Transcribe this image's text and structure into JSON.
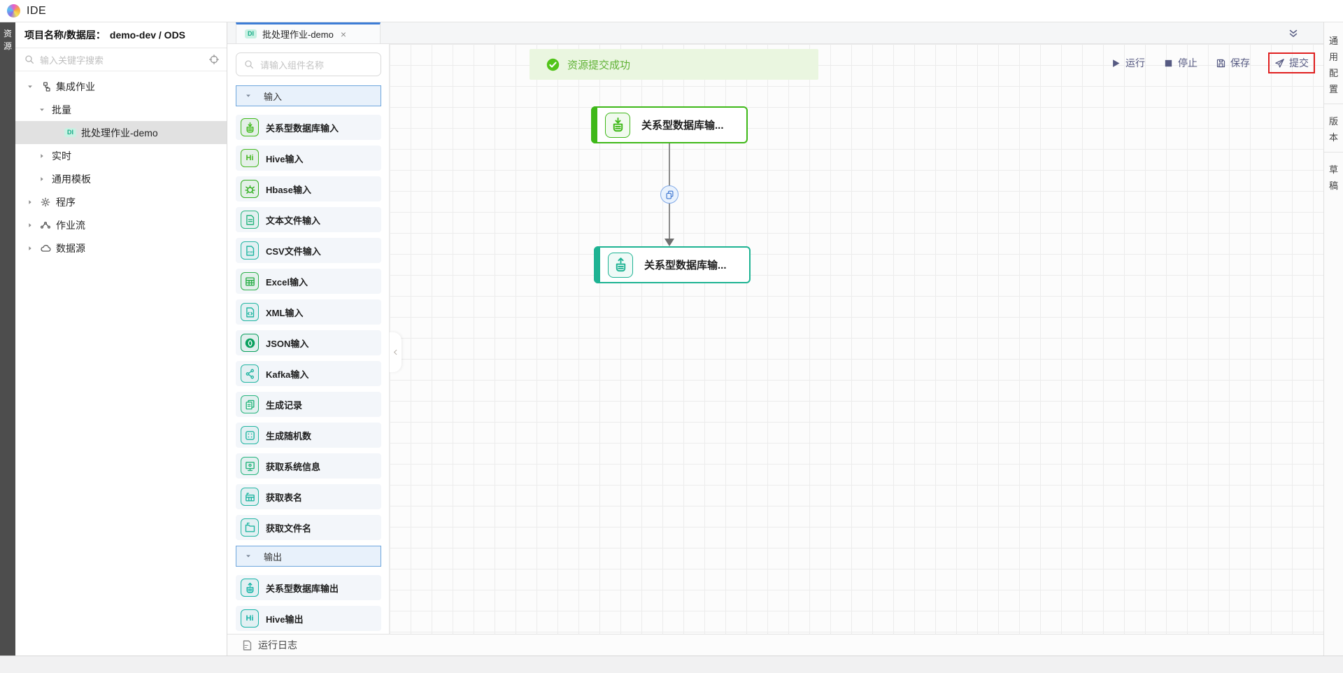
{
  "app": {
    "title": "IDE"
  },
  "activity_bar": {
    "label": "资源"
  },
  "sidebar": {
    "header_label": "项目名称/数据层：",
    "project_value": "demo-dev / ODS",
    "search_placeholder": "输入关键字搜索",
    "tree": [
      {
        "id": "integration-jobs",
        "label": "集成作业",
        "level": 0,
        "expanded": true,
        "icon": "sitemap"
      },
      {
        "id": "batch",
        "label": "批量",
        "level": 1,
        "expanded": true
      },
      {
        "id": "batch-job-demo",
        "label": "批处理作业-demo",
        "level": 2,
        "badge": "DI",
        "selected": true
      },
      {
        "id": "realtime",
        "label": "实时",
        "level": 1,
        "expanded": false
      },
      {
        "id": "common-template",
        "label": "通用模板",
        "level": 1,
        "expanded": false
      },
      {
        "id": "program",
        "label": "程序",
        "level": 0,
        "expanded": false,
        "icon": "gear"
      },
      {
        "id": "job-flow",
        "label": "作业流",
        "level": 0,
        "expanded": false,
        "icon": "flow"
      },
      {
        "id": "data-source",
        "label": "数据源",
        "level": 0,
        "expanded": false,
        "icon": "cloud"
      }
    ]
  },
  "tab": {
    "badge": "DI",
    "title": "批处理作业-demo",
    "close": "×"
  },
  "palette": {
    "search_placeholder": "请输入组件名称",
    "sections": [
      {
        "id": "input",
        "label": "输入",
        "items": [
          {
            "label": "关系型数据库输入",
            "icon": "db-in",
            "color": "#3eb818"
          },
          {
            "label": "Hive输入",
            "icon": "hive",
            "color": "#45b821"
          },
          {
            "label": "Hbase输入",
            "icon": "bug",
            "color": "#2fae1d"
          },
          {
            "label": "文本文件输入",
            "icon": "file-text",
            "color": "#27b57e"
          },
          {
            "label": "CSV文件输入",
            "icon": "file-csv",
            "color": "#23b6a2"
          },
          {
            "label": "Excel输入",
            "icon": "table",
            "color": "#2fb04c"
          },
          {
            "label": "XML输入",
            "icon": "file-xml",
            "color": "#23b6a2"
          },
          {
            "label": "JSON输入",
            "icon": "json",
            "color": "#0ba05e"
          },
          {
            "label": "Kafka输入",
            "icon": "kafka",
            "color": "#23b6a2"
          },
          {
            "label": "生成记录",
            "icon": "records",
            "color": "#27b57e"
          },
          {
            "label": "生成随机数",
            "icon": "dice",
            "color": "#23b6a2"
          },
          {
            "label": "获取系统信息",
            "icon": "monitor",
            "color": "#27b57e"
          },
          {
            "label": "获取表名",
            "icon": "table-flag",
            "color": "#23b6a2"
          },
          {
            "label": "获取文件名",
            "icon": "folder",
            "color": "#23b6a2"
          }
        ]
      },
      {
        "id": "output",
        "label": "输出",
        "items": [
          {
            "label": "关系型数据库输出",
            "icon": "db-out",
            "color": "#14b3a6"
          },
          {
            "label": "Hive输出",
            "icon": "hive",
            "color": "#14b3a6"
          }
        ]
      }
    ]
  },
  "toast": {
    "text": "资源提交成功",
    "icon_color": "#52c41a"
  },
  "toolbar": {
    "run_label": "运行",
    "stop_label": "停止",
    "save_label": "保存",
    "submit_label": "提交",
    "text_color": "#565a82",
    "highlight_color": "#e02020"
  },
  "canvas": {
    "nodes": [
      {
        "label": "关系型数据库输...",
        "icon": "db-in",
        "color": "#3eb818"
      },
      {
        "label": "关系型数据库输...",
        "icon": "db-out",
        "color": "#1eb393"
      }
    ],
    "edge": {
      "midpoint_icon": "copy",
      "midpoint_color": "#4a7fd4"
    }
  },
  "right_bar": {
    "tabs": [
      {
        "id": "general-config",
        "label": "通用配置"
      },
      {
        "id": "version",
        "label": "版本"
      },
      {
        "id": "draft",
        "label": "草稿"
      }
    ]
  },
  "log_bar": {
    "label": "运行日志"
  },
  "colors": {
    "accent_blue": "#3d7dd6",
    "selected_row": "#e1e1e1",
    "toast_bg": "#eaf6e0"
  }
}
